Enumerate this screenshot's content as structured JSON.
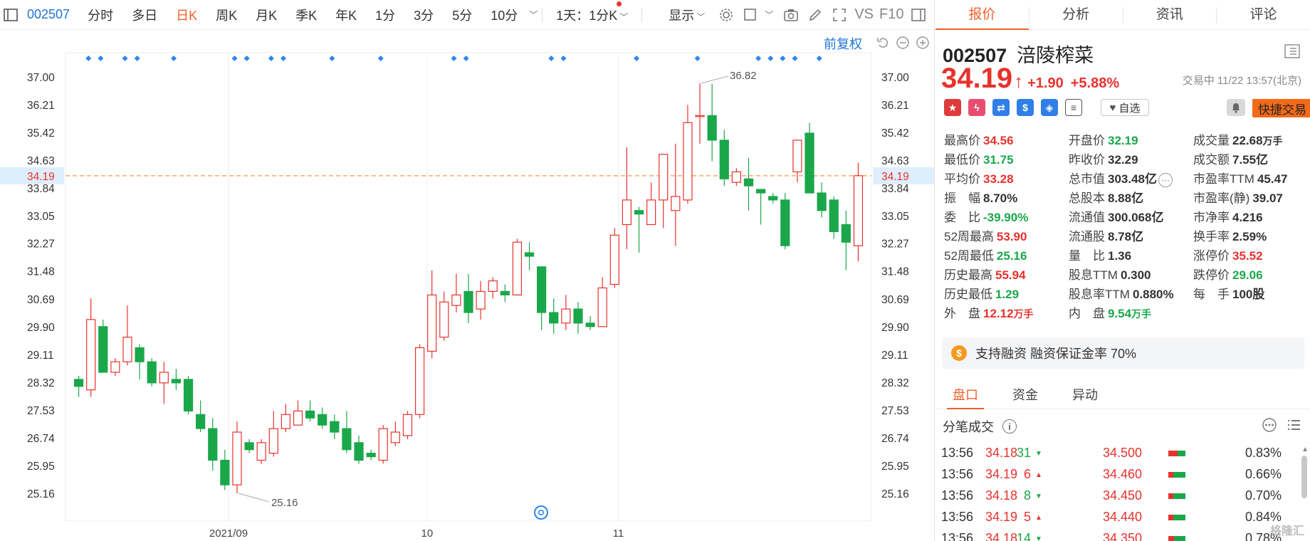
{
  "toolbar": {
    "code": "002507",
    "items": [
      "分时",
      "多日",
      "日K",
      "周K",
      "月K",
      "季K",
      "年K",
      "1分",
      "3分",
      "5分",
      "10分"
    ],
    "active": "日K",
    "period_select": "1天：1分K",
    "display_label": "显示",
    "vs_label": "VS",
    "f10_label": "F10"
  },
  "chart_toolbar": {
    "rehab_label": "前复权"
  },
  "chart_data": {
    "type": "candlestick",
    "price_axis_ticks": [
      37.0,
      36.21,
      35.42,
      34.63,
      33.84,
      33.05,
      32.27,
      31.48,
      30.69,
      29.9,
      29.11,
      28.32,
      27.53,
      26.74,
      25.95,
      25.16
    ],
    "current_price_label": "34.19",
    "max_label": "36.82",
    "min_label": "25.16",
    "x_ticks": [
      "2021/09",
      "10",
      "11"
    ],
    "candles": [
      {
        "o": 28.4,
        "c": 28.2,
        "h": 28.5,
        "l": 27.9
      },
      {
        "o": 28.1,
        "c": 30.1,
        "h": 30.7,
        "l": 27.9
      },
      {
        "o": 29.9,
        "c": 28.6,
        "h": 30.1,
        "l": 28.6
      },
      {
        "o": 28.6,
        "c": 28.9,
        "h": 29.0,
        "l": 28.5
      },
      {
        "o": 28.9,
        "c": 29.6,
        "h": 30.5,
        "l": 28.8
      },
      {
        "o": 29.3,
        "c": 28.9,
        "h": 29.4,
        "l": 28.4
      },
      {
        "o": 28.9,
        "c": 28.3,
        "h": 29.0,
        "l": 28.2
      },
      {
        "o": 28.3,
        "c": 28.6,
        "h": 28.9,
        "l": 27.7
      },
      {
        "o": 28.4,
        "c": 28.3,
        "h": 28.7,
        "l": 28.1
      },
      {
        "o": 28.4,
        "c": 27.5,
        "h": 28.5,
        "l": 27.4
      },
      {
        "o": 27.4,
        "c": 27.0,
        "h": 27.8,
        "l": 26.9
      },
      {
        "o": 27.0,
        "c": 26.1,
        "h": 27.3,
        "l": 25.8
      },
      {
        "o": 26.1,
        "c": 25.4,
        "h": 26.4,
        "l": 25.25
      },
      {
        "o": 25.4,
        "c": 26.9,
        "h": 27.2,
        "l": 25.16
      },
      {
        "o": 26.6,
        "c": 26.4,
        "h": 26.7,
        "l": 26.3
      },
      {
        "o": 26.1,
        "c": 26.6,
        "h": 26.7,
        "l": 26.0
      },
      {
        "o": 26.3,
        "c": 27.0,
        "h": 27.5,
        "l": 26.2
      },
      {
        "o": 27.0,
        "c": 27.4,
        "h": 27.7,
        "l": 26.9
      },
      {
        "o": 27.1,
        "c": 27.5,
        "h": 27.8,
        "l": 27.1
      },
      {
        "o": 27.5,
        "c": 27.3,
        "h": 27.8,
        "l": 27.2
      },
      {
        "o": 27.4,
        "c": 27.1,
        "h": 27.6,
        "l": 27.0
      },
      {
        "o": 27.2,
        "c": 26.9,
        "h": 27.4,
        "l": 26.7
      },
      {
        "o": 27.0,
        "c": 26.4,
        "h": 27.5,
        "l": 26.3
      },
      {
        "o": 26.6,
        "c": 26.1,
        "h": 26.8,
        "l": 26.0
      },
      {
        "o": 26.3,
        "c": 26.2,
        "h": 26.4,
        "l": 26.1
      },
      {
        "o": 26.1,
        "c": 27.0,
        "h": 27.1,
        "l": 26.0
      },
      {
        "o": 26.6,
        "c": 26.9,
        "h": 27.2,
        "l": 26.5
      },
      {
        "o": 26.8,
        "c": 27.4,
        "h": 27.5,
        "l": 26.7
      },
      {
        "o": 27.4,
        "c": 29.3,
        "h": 29.4,
        "l": 27.3
      },
      {
        "o": 29.2,
        "c": 30.8,
        "h": 31.5,
        "l": 29.0
      },
      {
        "o": 29.6,
        "c": 30.6,
        "h": 30.9,
        "l": 29.5
      },
      {
        "o": 30.5,
        "c": 30.8,
        "h": 31.4,
        "l": 30.3
      },
      {
        "o": 30.9,
        "c": 30.3,
        "h": 31.4,
        "l": 30.0
      },
      {
        "o": 30.4,
        "c": 30.9,
        "h": 31.2,
        "l": 30.1
      },
      {
        "o": 30.9,
        "c": 31.2,
        "h": 31.3,
        "l": 30.7
      },
      {
        "o": 30.9,
        "c": 30.8,
        "h": 31.1,
        "l": 30.6
      },
      {
        "o": 30.8,
        "c": 32.3,
        "h": 32.4,
        "l": 30.8
      },
      {
        "o": 32.0,
        "c": 31.9,
        "h": 32.3,
        "l": 31.5
      },
      {
        "o": 31.6,
        "c": 30.3,
        "h": 31.6,
        "l": 29.8
      },
      {
        "o": 30.3,
        "c": 30.0,
        "h": 30.7,
        "l": 29.7
      },
      {
        "o": 30.0,
        "c": 30.4,
        "h": 30.8,
        "l": 29.8
      },
      {
        "o": 30.4,
        "c": 30.0,
        "h": 30.6,
        "l": 29.7
      },
      {
        "o": 30.0,
        "c": 29.9,
        "h": 30.2,
        "l": 29.8
      },
      {
        "o": 29.9,
        "c": 31.0,
        "h": 31.3,
        "l": 29.9
      },
      {
        "o": 31.1,
        "c": 32.5,
        "h": 32.7,
        "l": 31.0
      },
      {
        "o": 32.8,
        "c": 33.5,
        "h": 35.0,
        "l": 32.1
      },
      {
        "o": 33.2,
        "c": 33.1,
        "h": 33.3,
        "l": 32.0
      },
      {
        "o": 32.8,
        "c": 33.5,
        "h": 34.0,
        "l": 32.8
      },
      {
        "o": 33.5,
        "c": 34.8,
        "h": 34.8,
        "l": 32.7
      },
      {
        "o": 33.2,
        "c": 33.6,
        "h": 35.1,
        "l": 32.2
      },
      {
        "o": 33.5,
        "c": 35.7,
        "h": 36.2,
        "l": 33.4
      },
      {
        "o": 35.9,
        "c": 35.9,
        "h": 36.82,
        "l": 35.1
      },
      {
        "o": 35.9,
        "c": 35.2,
        "h": 36.8,
        "l": 34.6
      },
      {
        "o": 35.2,
        "c": 34.1,
        "h": 35.5,
        "l": 33.9
      },
      {
        "o": 34.0,
        "c": 34.3,
        "h": 34.4,
        "l": 33.9
      },
      {
        "o": 34.1,
        "c": 33.9,
        "h": 34.7,
        "l": 33.2
      },
      {
        "o": 33.8,
        "c": 33.7,
        "h": 33.8,
        "l": 32.8
      },
      {
        "o": 33.6,
        "c": 33.5,
        "h": 33.7,
        "l": 33.4
      },
      {
        "o": 33.5,
        "c": 32.2,
        "h": 33.7,
        "l": 32.1
      },
      {
        "o": 34.3,
        "c": 35.2,
        "h": 35.2,
        "l": 34.0
      },
      {
        "o": 35.4,
        "c": 33.7,
        "h": 35.7,
        "l": 33.7
      },
      {
        "o": 33.7,
        "c": 33.2,
        "h": 34.0,
        "l": 33.0
      },
      {
        "o": 33.5,
        "c": 32.6,
        "h": 33.6,
        "l": 32.4
      },
      {
        "o": 32.8,
        "c": 32.3,
        "h": 33.2,
        "l": 31.5
      },
      {
        "o": 32.2,
        "c": 34.19,
        "h": 34.56,
        "l": 31.75
      }
    ],
    "ylim": [
      24.9,
      37.5
    ]
  },
  "quote_tabs": [
    "报价",
    "分析",
    "资讯",
    "评论"
  ],
  "stock": {
    "code": "002507",
    "name": "涪陵榨菜",
    "price": "34.19",
    "change": "+1.90",
    "pct": "+5.88%",
    "status_time": "交易中 11/22 13:57(北京)",
    "watch_label": "自选",
    "fast_trade": "快捷交易"
  },
  "quote_rows": [
    [
      {
        "l": "最高价",
        "v": "34.56",
        "c": "red"
      },
      {
        "l": "开盘价",
        "v": "32.19",
        "c": "green"
      },
      {
        "l": "成交量",
        "v": "22.68",
        "u": "万手",
        "c": "black"
      }
    ],
    [
      {
        "l": "最低价",
        "v": "31.75",
        "c": "green"
      },
      {
        "l": "昨收价",
        "v": "32.29",
        "c": "black"
      },
      {
        "l": "成交额",
        "v": "7.55亿",
        "c": "black"
      }
    ],
    [
      {
        "l": "平均价",
        "v": "33.28",
        "c": "red"
      },
      {
        "l": "总市值",
        "v": "303.48亿",
        "c": "black",
        "more": true
      },
      {
        "l": "市盈率TTM",
        "v": "45.47",
        "c": "black"
      }
    ],
    [
      {
        "l": "振　幅",
        "v": "8.70%",
        "c": "black"
      },
      {
        "l": "总股本",
        "v": "8.88亿",
        "c": "black"
      },
      {
        "l": "市盈率(静)",
        "v": "39.07",
        "c": "black"
      }
    ],
    [
      {
        "l": "委　比",
        "v": "-39.90%",
        "c": "green"
      },
      {
        "l": "流通值",
        "v": "300.068亿",
        "c": "black"
      },
      {
        "l": "市净率",
        "v": "4.216",
        "c": "black"
      }
    ],
    [
      {
        "l": "52周最高",
        "v": "53.90",
        "c": "red"
      },
      {
        "l": "流通股",
        "v": "8.78亿",
        "c": "black"
      },
      {
        "l": "换手率",
        "v": "2.59%",
        "c": "black"
      }
    ],
    [
      {
        "l": "52周最低",
        "v": "25.16",
        "c": "green"
      },
      {
        "l": "量　比",
        "v": "1.36",
        "c": "black"
      },
      {
        "l": "涨停价",
        "v": "35.52",
        "c": "red"
      }
    ],
    [
      {
        "l": "历史最高",
        "v": "55.94",
        "c": "red"
      },
      {
        "l": "股息TTM",
        "v": "0.300",
        "c": "black"
      },
      {
        "l": "跌停价",
        "v": "29.06",
        "c": "green"
      }
    ],
    [
      {
        "l": "历史最低",
        "v": "1.29",
        "c": "green"
      },
      {
        "l": "股息率TTM",
        "v": "0.880%",
        "c": "black"
      },
      {
        "l": "每　手",
        "v": "100股",
        "c": "black"
      }
    ],
    [
      {
        "l": "外　盘",
        "v": "12.12",
        "u": "万手",
        "c": "red"
      },
      {
        "l": "内　盘",
        "v": "9.54",
        "u": "万手",
        "c": "green"
      }
    ]
  ],
  "finance": {
    "text": "支持融资 融资保证金率 70%"
  },
  "sub_tabs": [
    "盘口",
    "资金",
    "异动"
  ],
  "ticks": {
    "title": "分笔成交",
    "rows": [
      {
        "time": "13:56",
        "price": "34.18",
        "vol": "31",
        "dir": "down",
        "lvl": "34.500",
        "pct": "0.83%",
        "r": 0.55
      },
      {
        "time": "13:56",
        "price": "34.19",
        "vol": "6",
        "dir": "up",
        "lvl": "34.460",
        "pct": "0.66%",
        "r": 0.3
      },
      {
        "time": "13:56",
        "price": "34.18",
        "vol": "8",
        "dir": "down",
        "lvl": "34.450",
        "pct": "0.70%",
        "r": 0.3
      },
      {
        "time": "13:56",
        "price": "34.19",
        "vol": "5",
        "dir": "up",
        "lvl": "34.440",
        "pct": "0.84%",
        "r": 0.3
      },
      {
        "time": "13:56",
        "price": "34.18",
        "vol": "14",
        "dir": "down",
        "lvl": "34.350",
        "pct": "0.78%",
        "r": 0.35
      }
    ]
  },
  "colors": {
    "up": "#e8322d",
    "down": "#1aa74a",
    "accent": "#f0602a",
    "link": "#1f73d8"
  },
  "watermark": "格隆汇"
}
